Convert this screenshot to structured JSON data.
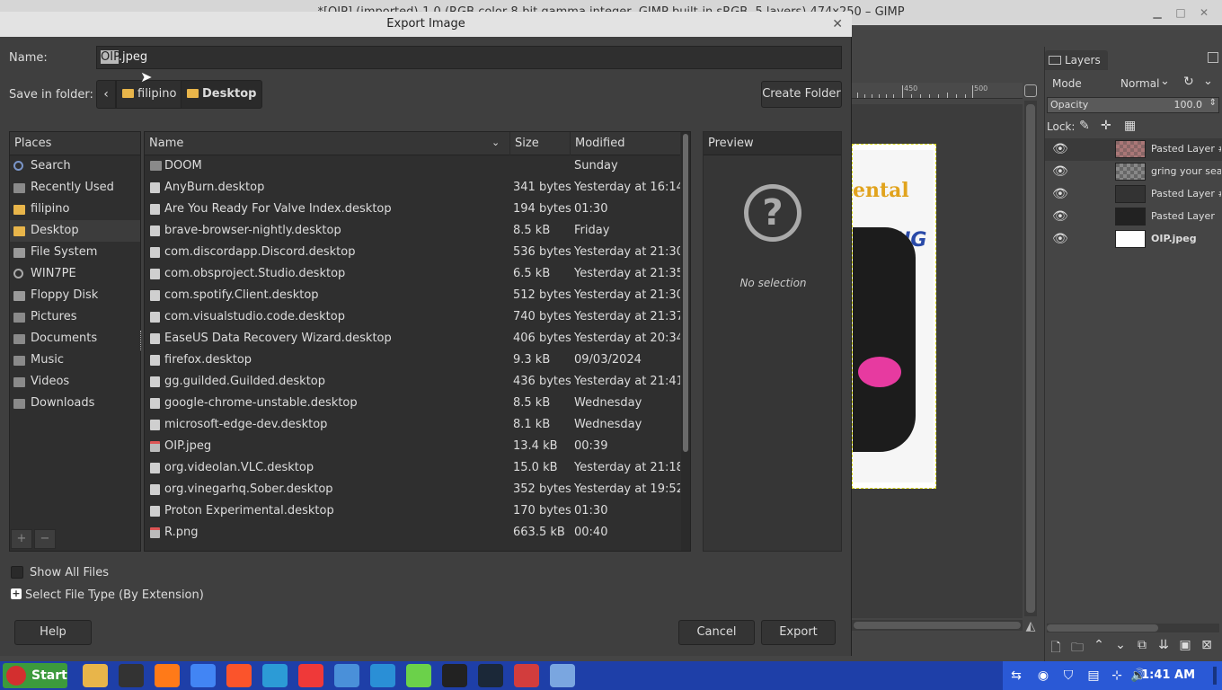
{
  "gimp_window": {
    "title": "*[OIP] (imported)-1.0 (RGB color 8-bit gamma integer, GIMP built-in sRGB, 5 layers) 474x250 – GIMP"
  },
  "ruler": {
    "labels": [
      "450",
      "500"
    ]
  },
  "canvas_image": {
    "text1": "ental",
    "text2": "NG"
  },
  "layers_panel": {
    "tab_label": "Layers",
    "mode_label": "Mode",
    "mode_value": "Normal",
    "opacity_label": "Opacity",
    "opacity_value": "100.0",
    "opacity_fraction": 1.0,
    "lock_label": "Lock:",
    "layers": [
      {
        "name": "Pasted Layer #",
        "visible": true,
        "active": true
      },
      {
        "name": "gring your sear",
        "visible": true
      },
      {
        "name": "Pasted Layer #",
        "visible": true
      },
      {
        "name": "Pasted Layer",
        "visible": true
      },
      {
        "name": "OIP.jpeg",
        "visible": true,
        "bold": true
      }
    ]
  },
  "dialog": {
    "title": "Export Image",
    "name_label": "Name:",
    "name_selected": "OIP",
    "name_rest": ".jpeg",
    "folder_label": "Save in folder:",
    "path": [
      "filipino",
      "Desktop"
    ],
    "create_folder_label": "Create Folder",
    "places_header": "Places",
    "places": [
      "Search",
      "Recently Used",
      "filipino",
      "Desktop",
      "File System",
      "WIN7PE",
      "Floppy Disk",
      "Pictures",
      "Documents",
      "Music",
      "Videos",
      "Downloads"
    ],
    "places_selected": "Desktop",
    "columns": {
      "name": "Name",
      "size": "Size",
      "modified": "Modified"
    },
    "files": [
      {
        "name": "DOOM",
        "size": "",
        "modified": "Sunday",
        "kind": "folder"
      },
      {
        "name": "AnyBurn.desktop",
        "size": "341 bytes",
        "modified": "Yesterday at 16:14",
        "kind": "file"
      },
      {
        "name": "Are You Ready For Valve Index.desktop",
        "size": "194 bytes",
        "modified": "01:30",
        "kind": "file"
      },
      {
        "name": "brave-browser-nightly.desktop",
        "size": "8.5 kB",
        "modified": "Friday",
        "kind": "file"
      },
      {
        "name": "com.discordapp.Discord.desktop",
        "size": "536 bytes",
        "modified": "Yesterday at 21:30",
        "kind": "file"
      },
      {
        "name": "com.obsproject.Studio.desktop",
        "size": "6.5 kB",
        "modified": "Yesterday at 21:35",
        "kind": "file"
      },
      {
        "name": "com.spotify.Client.desktop",
        "size": "512 bytes",
        "modified": "Yesterday at 21:30",
        "kind": "file"
      },
      {
        "name": "com.visualstudio.code.desktop",
        "size": "740 bytes",
        "modified": "Yesterday at 21:37",
        "kind": "file"
      },
      {
        "name": "EaseUS Data Recovery Wizard.desktop",
        "size": "406 bytes",
        "modified": "Yesterday at 20:34",
        "kind": "file"
      },
      {
        "name": "firefox.desktop",
        "size": "9.3 kB",
        "modified": "09/03/2024",
        "kind": "file"
      },
      {
        "name": "gg.guilded.Guilded.desktop",
        "size": "436 bytes",
        "modified": "Yesterday at 21:41",
        "kind": "file"
      },
      {
        "name": "google-chrome-unstable.desktop",
        "size": "8.5 kB",
        "modified": "Wednesday",
        "kind": "file"
      },
      {
        "name": "microsoft-edge-dev.desktop",
        "size": "8.1 kB",
        "modified": "Wednesday",
        "kind": "file"
      },
      {
        "name": "OIP.jpeg",
        "size": "13.4 kB",
        "modified": "00:39",
        "kind": "image"
      },
      {
        "name": "org.videolan.VLC.desktop",
        "size": "15.0 kB",
        "modified": "Yesterday at 21:18",
        "kind": "file"
      },
      {
        "name": "org.vinegarhq.Sober.desktop",
        "size": "352 bytes",
        "modified": "Yesterday at 19:52",
        "kind": "file"
      },
      {
        "name": "Proton Experimental.desktop",
        "size": "170 bytes",
        "modified": "01:30",
        "kind": "file"
      },
      {
        "name": "R.png",
        "size": "663.5 kB",
        "modified": "00:40",
        "kind": "image"
      }
    ],
    "preview_header": "Preview",
    "preview_empty": "No selection",
    "show_all_files_label": "Show All Files",
    "show_all_files_checked": false,
    "file_type_label": "Select File Type (By Extension)",
    "help_label": "Help",
    "cancel_label": "Cancel",
    "export_label": "Export"
  },
  "taskbar": {
    "start_label": "Start",
    "apps": [
      "file-manager-icon",
      "obs-icon",
      "firefox-icon",
      "chrome-icon",
      "brave-icon",
      "edge-dev-icon",
      "vivaldi-icon",
      "flatpak-icon",
      "monitor-icon",
      "apps-grid-icon",
      "terminal-icon",
      "steam-icon",
      "gimp-icon",
      "network-share-icon"
    ],
    "clock": "1:41 AM"
  },
  "colors": {
    "taskbar": "#1e3fa8",
    "tray": "#2a59d6",
    "start": "#3c9a3c",
    "folder_accent": "#e8b54a"
  }
}
